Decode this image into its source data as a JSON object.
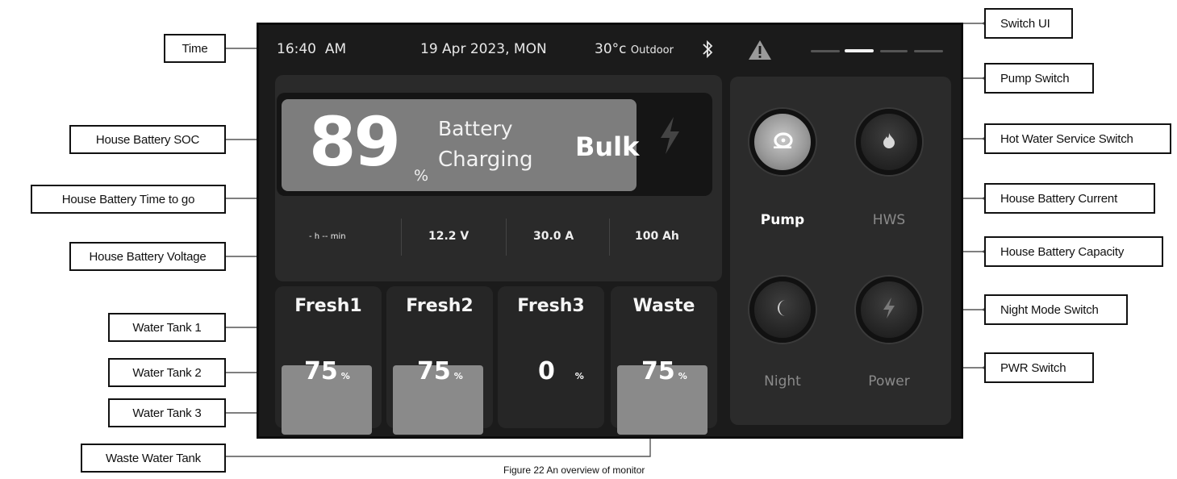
{
  "monitor": {
    "time": "16:40",
    "ampm": "AM",
    "date": "19 Apr 2023, MON",
    "temp": "30°c",
    "temp_label": "Outdoor",
    "battery": {
      "soc": "89",
      "soc_unit": "%",
      "status_line1": "Battery",
      "status_line2": "Charging",
      "stage": "Bulk",
      "time_to_go": "- h -- min",
      "voltage": "12.2 V",
      "current": "30.0 A",
      "capacity": "100 Ah"
    },
    "tanks": [
      {
        "name": "Fresh1",
        "value": "75",
        "unit": "%",
        "level": 0.75
      },
      {
        "name": "Fresh2",
        "value": "75",
        "unit": "%",
        "level": 0.75
      },
      {
        "name": "Fresh3",
        "value": "0",
        "unit": "%",
        "level": 0.0
      },
      {
        "name": "Waste",
        "value": "75",
        "unit": "%",
        "level": 0.75
      }
    ],
    "switches": [
      {
        "label": "Pump",
        "icon": "pump-icon",
        "on": true
      },
      {
        "label": "HWS",
        "icon": "flame-icon",
        "on": false
      },
      {
        "label": "Night",
        "icon": "moon-icon",
        "on": false
      },
      {
        "label": "Power",
        "icon": "lightning-icon",
        "on": false
      }
    ],
    "pages": {
      "count": 4,
      "active": 1
    }
  },
  "callouts": {
    "time": "Time",
    "soc": "House Battery SOC",
    "ttg": "House Battery Time to go",
    "voltage": "House Battery Voltage",
    "tank1": "Water Tank 1",
    "tank2": "Water Tank 2",
    "tank3": "Water Tank 3",
    "waste": "Waste Water Tank",
    "switch_ui": "Switch UI",
    "pump": "Pump Switch",
    "hws": "Hot Water Service Switch",
    "current": "House Battery Current",
    "capacity": "House Battery Capacity",
    "night": "Night Mode Switch",
    "pwr": "PWR Switch"
  },
  "caption": "Figure 22 An overview of monitor",
  "colors": {
    "panel": "#1b1b1b",
    "card": "#7d7d7d",
    "tank_fill": "#8a8a8a"
  }
}
